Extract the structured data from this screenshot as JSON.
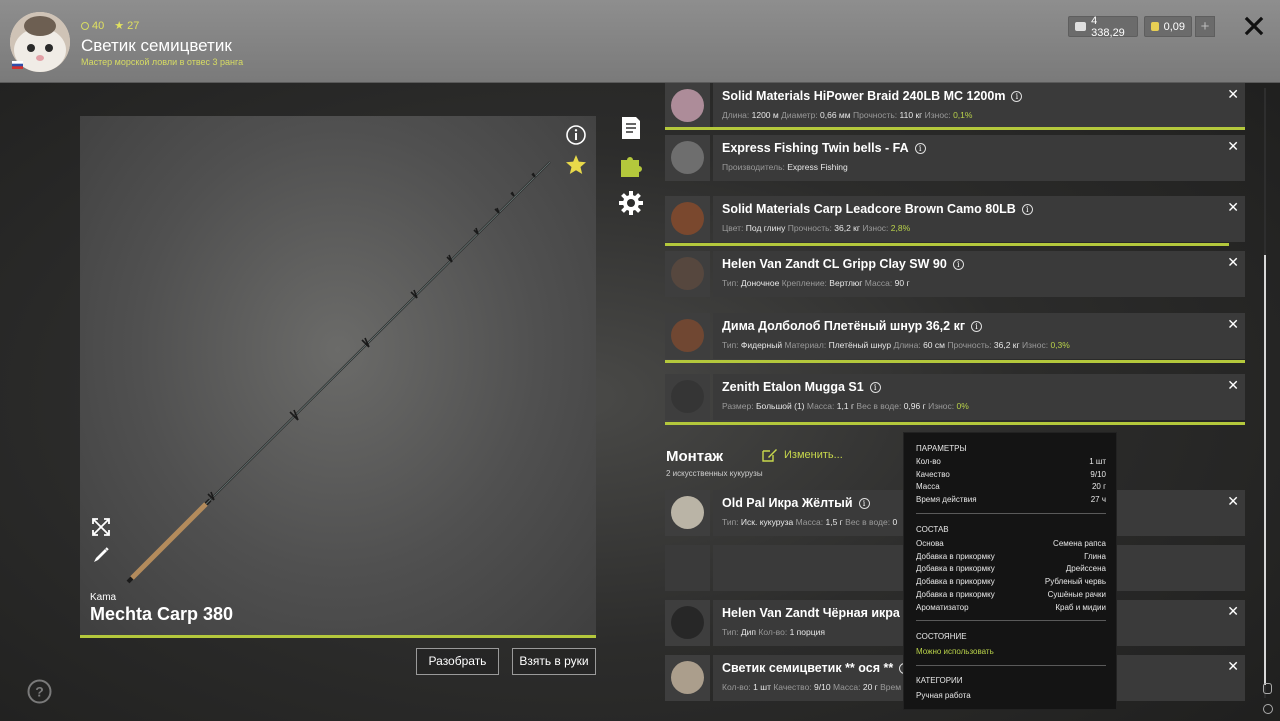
{
  "header": {
    "stat_coins": "40",
    "stat_stars": "27",
    "player_name": "Светик семицветик",
    "player_rank": "Мастер морской ловли в отвес 3 ранга",
    "silver": "4 338,29",
    "gold": "0,09",
    "plus": "+",
    "close": "✕"
  },
  "rod": {
    "brand": "Kama",
    "name": "Mechta Carp 380",
    "disassemble": "Разобрать",
    "take": "Взять в руки"
  },
  "items": [
    {
      "title": "Solid Materials HiPower Braid 240LB MC 1200m",
      "props": [
        [
          "Длина:",
          "1200 м"
        ],
        [
          "Диаметр:",
          "0,66 мм"
        ],
        [
          "Прочность:",
          "110 кг"
        ],
        [
          "Износ:",
          "0,1%"
        ]
      ]
    },
    {
      "title": "Express Fishing Twin bells - FA",
      "props": [
        [
          "Производитель:",
          "Express Fishing"
        ]
      ]
    },
    {
      "title": "Solid Materials Carp Leadcore Brown Camo 80LB",
      "props": [
        [
          "Цвет:",
          "Под глину"
        ],
        [
          "Прочность:",
          "36,2 кг"
        ],
        [
          "Износ:",
          "2,8%"
        ]
      ]
    },
    {
      "title": "Helen Van Zandt CL Gripp Clay SW 90",
      "props": [
        [
          "Тип:",
          "Доночное"
        ],
        [
          "Крепление:",
          "Вертлюг"
        ],
        [
          "Масса:",
          "90 г"
        ]
      ]
    },
    {
      "title": "Дима Долболоб Плетёный шнур 36,2 кг",
      "props": [
        [
          "Тип:",
          "Фидерный"
        ],
        [
          "Материал:",
          "Плетёный шнур"
        ],
        [
          "Длина:",
          "60 см"
        ],
        [
          "Прочность:",
          "36,2 кг"
        ],
        [
          "Износ:",
          "0,3%"
        ]
      ]
    },
    {
      "title": "Zenith Etalon Mugga S1",
      "props": [
        [
          "Размер:",
          "Большой (1)"
        ],
        [
          "Масса:",
          "1,1 г"
        ],
        [
          "Вес в воде:",
          "0,96 г"
        ],
        [
          "Износ:",
          "0%"
        ]
      ]
    },
    {
      "title": "Old Pal Икра Жёлтый",
      "props": [
        [
          "Тип:",
          "Иск. кукуруза"
        ],
        [
          "Масса:",
          "1,5 г"
        ],
        [
          "Вес в воде:",
          "0"
        ]
      ]
    },
    {
      "title": "Helen Van Zandt Чёрная икра",
      "props": [
        [
          "Тип:",
          "Дип"
        ],
        [
          "Кол-во:",
          "1 порция"
        ]
      ]
    },
    {
      "title": "Светик семицветик ** ося **",
      "props": [
        [
          "Кол-во:",
          "1 шт"
        ],
        [
          "Качество:",
          "9/10"
        ],
        [
          "Масса:",
          "20 г"
        ],
        [
          "Врем",
          ""
        ]
      ]
    }
  ],
  "rig": {
    "title": "Монтаж",
    "subtitle": "2 искусственных кукурузы",
    "edit": "Изменить..."
  },
  "tooltip": {
    "params_header": "ПАРАМЕТРЫ",
    "params": [
      [
        "Кол-во",
        "1 шт"
      ],
      [
        "Качество",
        "9/10"
      ],
      [
        "Масса",
        "20 г"
      ],
      [
        "Время действия",
        "27 ч"
      ]
    ],
    "composition_header": "СОСТАВ",
    "composition": [
      [
        "Основа",
        "Семена рапса"
      ],
      [
        "Добавка в прикормку",
        "Глина"
      ],
      [
        "Добавка в прикормку",
        "Дрейссена"
      ],
      [
        "Добавка в прикормку",
        "Рубленый червь"
      ],
      [
        "Добавка в прикормку",
        "Сушёные рачки"
      ],
      [
        "Ароматизатор",
        "Краб и мидии"
      ]
    ],
    "state_header": "СОСТОЯНИЕ",
    "state": "Можно использовать",
    "categories_header": "КАТЕГОРИИ",
    "category": "Ручная работа"
  },
  "colors": {
    "accent": "#b4c83c",
    "good": "#b9d24a",
    "rank": "#d7dc63"
  },
  "icons": [
    "info-icon",
    "favorite-star-icon",
    "notes-icon",
    "puzzle-icon",
    "gear-icon",
    "expand-icon",
    "edit-icon",
    "help-icon",
    "close-icon",
    "silver-coin-icon",
    "gold-coin-icon"
  ]
}
